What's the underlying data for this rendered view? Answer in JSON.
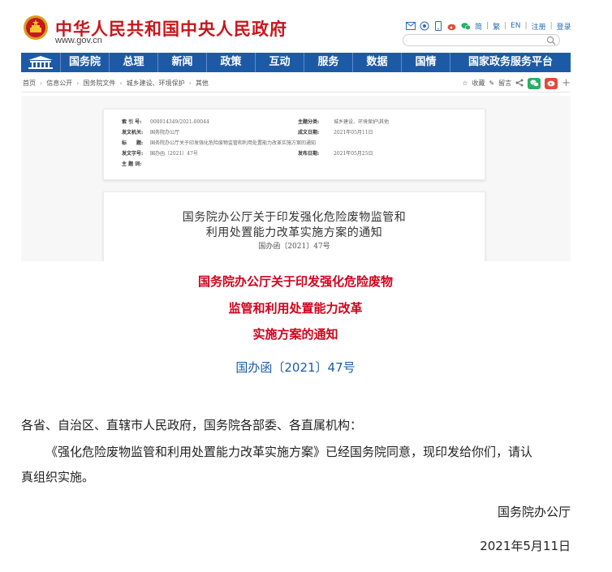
{
  "header": {
    "site_title": "中华人民共和国中央人民政府",
    "site_url": "www.gov.cn",
    "tools": [
      "简",
      "繁",
      "EN",
      "注册",
      "登录"
    ],
    "search_placeholder": ""
  },
  "nav": {
    "items": [
      "国务院",
      "总理",
      "新闻",
      "政策",
      "互动",
      "服务",
      "数据",
      "国情",
      "国家政务服务平台"
    ]
  },
  "breadcrumb": {
    "items": [
      "首页",
      "信息公开",
      "国务院文件",
      "城乡建设、环境保护",
      "其他"
    ],
    "actions": {
      "favorite": "收藏",
      "print": "留言"
    }
  },
  "scan": {
    "meta": {
      "index_label": "索 引 号:",
      "index_value": "000014349/2021-00044",
      "topic_label": "主题分类:",
      "topic_value": "城乡建设、环境保护\\其他",
      "issuer_label": "发文机关:",
      "issuer_value": "国务院办公厅",
      "date_label": "成文日期:",
      "date_value": "2021年05月11日",
      "title_label": "标　　题:",
      "title_value": "国务院办公厅关于印发强化危险废物监管和利用处置能力改革实施方案的通知",
      "number_label": "发文字号:",
      "number_value": "国办函〔2021〕47号",
      "publish_label": "发布日期:",
      "publish_value": "2021年05月25日",
      "keywords_label": "主 题 词:"
    },
    "doc": {
      "line1": "国务院办公厅关于印发强化危险废物监管和",
      "line2": "利用处置能力改革实施方案的通知",
      "line3": "国办函〔2021〕47号"
    }
  },
  "article": {
    "title_lines": [
      "国务院办公厅关于印发强化危险废物",
      "监管和利用处置能力改革",
      "实施方案的通知"
    ],
    "doc_number": "国办函〔2021〕47号",
    "salutation": "各省、自治区、直辖市人民政府，国务院各部委、各直属机构：",
    "body_line1": "《强化危险废物监管和利用处置能力改革实施方案》已经国务院同意，现印发给你们，请认",
    "body_line2": "真组织实施。",
    "signature": "国务院办公厅",
    "date": "2021年5月11日"
  },
  "colors": {
    "brand_red": "#c8161d",
    "nav_blue": "#1d5aa6",
    "title_red": "#d0021b"
  }
}
